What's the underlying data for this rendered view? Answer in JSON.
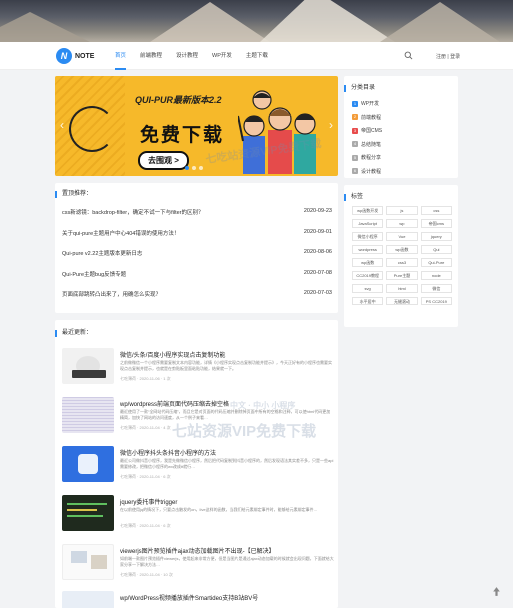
{
  "nav": {
    "logo_letter": "N",
    "logo_text": "NOTE",
    "menu": [
      "首页",
      "前端教程",
      "设计教程",
      "WP开发",
      "主题下载"
    ],
    "login": "注册 | 登录"
  },
  "banner": {
    "title": "QUI-PUR最新版本2.2",
    "headline": "免费下载",
    "button": "去围观 >",
    "arrow_left": "‹",
    "arrow_right": "›"
  },
  "pinned": {
    "title": "置顶推荐：",
    "items": [
      {
        "title": "css新滤镜：backdrop-filter，确定不试一下与filter的区别？",
        "date": "2020-09-23"
      },
      {
        "title": "关于qui-pure主题用户中心404错误的使用方法！",
        "date": "2020-09-01"
      },
      {
        "title": "Qui-pure v2.22主题版本更新日志",
        "date": "2020-08-06"
      },
      {
        "title": "Qui-Pure主题bug反馈专题",
        "date": "2020-07-08"
      },
      {
        "title": "页面底部跳转凸出来了，用确怎么实现？",
        "date": "2020-07-03"
      }
    ]
  },
  "latest": {
    "title": "最近更新：",
    "posts": [
      {
        "title": "微信/头条/百度小程序实现点击复制功能",
        "excerpt": "之前做微信一个小程序需要复制文本内容功能，详情《小程序实现点击复制功能并提示》，今天正好有的小程序也需要实现点击复制并提示，也就是在剪贴板里面粘贴功能，结果就一下。",
        "meta": "七吃薄荷 · 2020-11-06 · 1 次"
      },
      {
        "title": "wp/wordpress前端页面代码压缩去掉空格",
        "excerpt": "最近使用了一款“全网站代码压缩”，而且它是对页面的代码压缩并删除掉页面中所有的空格和注释，可以使html代码更加精简，加快了网站的访问速度，从一个例子来看…",
        "meta": "七吃薄荷 · 2020-11-04 · 4 次"
      },
      {
        "title": "微信小程序抖头条抖音小程序的方法",
        "excerpt": "最近公司做抖音小程序，我是先做微信小程序，然后把代码复制到抖音小程序的，然后发现语法其实差不多，只是一些api需要修改，把微信小程序的wx改成tt就行…",
        "meta": "七吃薄荷 · 2020-11-04 · 6 次"
      },
      {
        "title": "jquery委托事件trigger",
        "excerpt": "在以前使用jq的情况下，只要点击触发的on，live这样的函数，当我们给元素绑定事件时，能够给元素绑定事件…",
        "meta": "七吃薄荷 · 2020-11-04 · 6 次"
      },
      {
        "title": "viewerjs图片预览插件ajax动态加载图片不出现-【已解决】",
        "excerpt": "如前端一款图片预览插件viewerjs，使用起来非常方便，但是当图片是通过ajax动态加载的时候就会出现问题，下面就给大家分享一下解决方法…",
        "meta": "七吃薄荷 · 2020-11-04 · 10 次"
      },
      {
        "title": "wp/WordPress视频播放插件Smartideo支持B站BV号"
      }
    ]
  },
  "categories": {
    "title": "分类目录",
    "items": [
      {
        "num": "1",
        "label": "WP开发",
        "color": "#2b8bf2"
      },
      {
        "num": "2",
        "label": "前端教程",
        "color": "#f39c3a"
      },
      {
        "num": "3",
        "label": "帝国CMS",
        "color": "#e84c4c"
      },
      {
        "num": "4",
        "label": "总结随笔",
        "color": "#aaaaaa"
      },
      {
        "num": "5",
        "label": "教程分享",
        "color": "#aaaaaa"
      },
      {
        "num": "6",
        "label": "设计教程",
        "color": "#aaaaaa"
      }
    ]
  },
  "tags": {
    "title": "标签",
    "items": [
      "wp函数开发",
      "js",
      "css",
      "JavaScript",
      "wp",
      "帝国cms",
      "微信小程序",
      "Vue",
      "jquery",
      "wordpress",
      "wp函数",
      "Qui",
      "wp函数",
      "css3",
      "Qui-Pure",
      "CC2019教程",
      "Pure主题",
      "node",
      "svg",
      "html",
      "微信",
      "水平居中",
      "无缝滚动",
      "PS CC2019"
    ]
  },
  "watermark": {
    "line1": "七吃站资源VIP免费下载",
    "line2": "中文 · 中小 小程序",
    "line3": "七站资源VIP免费下载"
  }
}
